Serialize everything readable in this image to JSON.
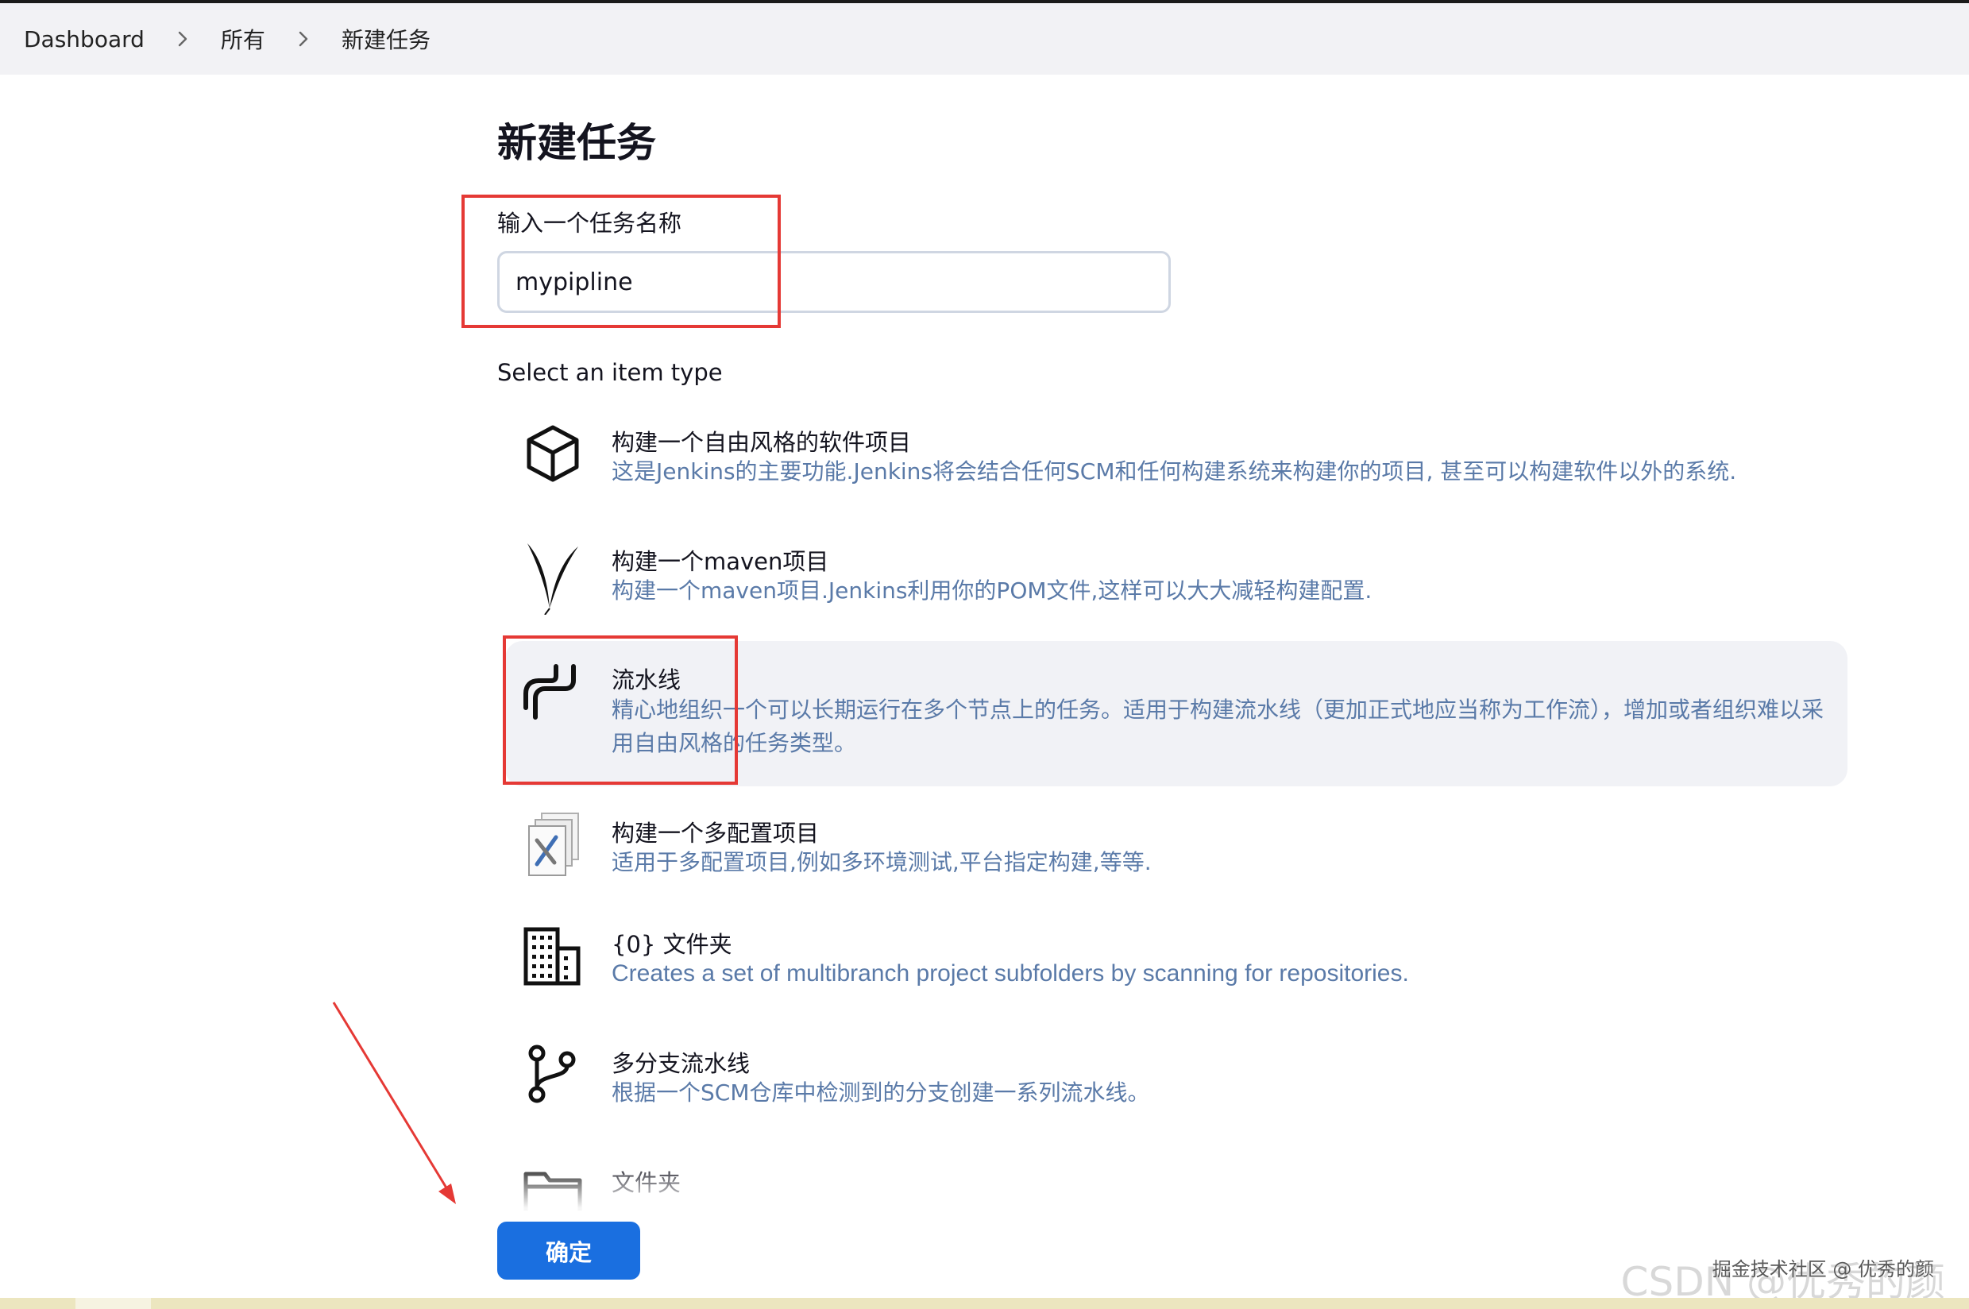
{
  "breadcrumb": {
    "items": [
      "Dashboard",
      "所有",
      "新建任务"
    ]
  },
  "page": {
    "title": "新建任务",
    "name_label": "输入一个任务名称",
    "name_value": "mypipline",
    "select_label": "Select an item type"
  },
  "item_types": [
    {
      "icon": "cube-icon",
      "title": "构建一个自由风格的软件项目",
      "desc": "这是Jenkins的主要功能.Jenkins将会结合任何SCM和任何构建系统来构建你的项目, 甚至可以构建软件以外的系统."
    },
    {
      "icon": "feather-icon",
      "title": "构建一个maven项目",
      "desc": "构建一个maven项目.Jenkins利用你的POM文件,这样可以大大减轻构建配置."
    },
    {
      "icon": "pipeline-icon",
      "title": "流水线",
      "desc": "精心地组织一个可以长期运行在多个节点上的任务。适用于构建流水线（更加正式地应当称为工作流），增加或者组织难以采用自由风格的任务类型。",
      "selected": true
    },
    {
      "icon": "multi-config-icon",
      "title": "构建一个多配置项目",
      "desc": "适用于多配置项目,例如多环境测试,平台指定构建,等等."
    },
    {
      "icon": "building-icon",
      "title": "{0} 文件夹",
      "desc": "Creates a set of multibranch project subfolders by scanning for repositories."
    },
    {
      "icon": "branch-icon",
      "title": "多分支流水线",
      "desc": "根据一个SCM仓库中检测到的分支创建一系列流水线。"
    },
    {
      "icon": "folder-icon",
      "title": "文件夹",
      "desc": ""
    }
  ],
  "actions": {
    "ok_label": "确定"
  },
  "watermark": {
    "back": "CSDN @优秀的颜",
    "front": "掘金技术社区 @ 优秀的颜"
  },
  "colors": {
    "accent": "#1a6fe0",
    "annotation_red": "#e53935",
    "desc_text": "#5a7aa8",
    "selected_bg": "#f1f2f6"
  }
}
